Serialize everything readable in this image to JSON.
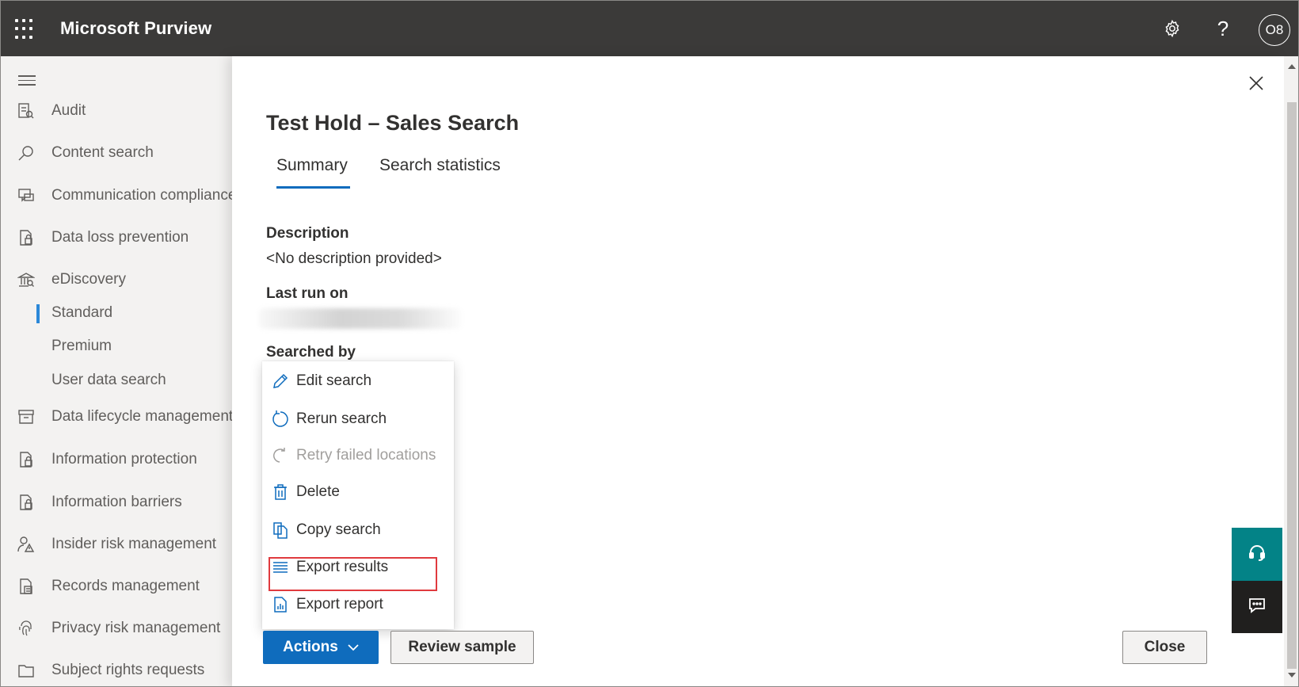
{
  "app": {
    "title": "Microsoft Purview",
    "user_initials": "O8"
  },
  "header": {
    "icons": [
      "waffle-icon",
      "settings-icon",
      "help-icon"
    ],
    "help_glyph": "?"
  },
  "sidebar": {
    "items": [
      {
        "label": "Audit",
        "icon": "audit-icon"
      },
      {
        "label": "Content search",
        "icon": "search-icon"
      },
      {
        "label": "Communication compliance",
        "icon": "chat-icon"
      },
      {
        "label": "Data loss prevention",
        "icon": "lock-document-icon"
      },
      {
        "label": "eDiscovery",
        "icon": "building-icon"
      },
      {
        "label": "Data lifecycle management",
        "icon": "archive-icon"
      },
      {
        "label": "Information protection",
        "icon": "lock-document-icon"
      },
      {
        "label": "Information barriers",
        "icon": "lock-document-icon"
      },
      {
        "label": "Insider risk management",
        "icon": "person-warning-icon"
      },
      {
        "label": "Records management",
        "icon": "records-icon"
      },
      {
        "label": "Privacy risk management",
        "icon": "fingerprint-icon"
      },
      {
        "label": "Subject rights requests",
        "icon": "folder-icon"
      }
    ],
    "ediscovery_sub": [
      "Standard",
      "Premium",
      "User data search"
    ],
    "selected_sub": "Standard"
  },
  "panel": {
    "title": "Test Hold – Sales Search",
    "tabs": [
      {
        "label": "Summary",
        "active": true
      },
      {
        "label": "Search statistics",
        "active": false
      }
    ],
    "fields": {
      "description_label": "Description",
      "description_value": "<No description provided>",
      "last_run_label": "Last run on",
      "searched_by_label": "Searched by"
    }
  },
  "menu": {
    "items": [
      {
        "label": "Edit search",
        "icon": "pencil-icon",
        "disabled": false
      },
      {
        "label": "Rerun search",
        "icon": "refresh-icon",
        "disabled": false
      },
      {
        "label": "Retry failed locations",
        "icon": "retry-icon",
        "disabled": true
      },
      {
        "label": "Delete",
        "icon": "trash-icon",
        "disabled": false
      },
      {
        "label": "Copy search",
        "icon": "copy-icon",
        "disabled": false
      },
      {
        "label": "Export results",
        "icon": "list-icon",
        "disabled": false,
        "highlighted": true
      },
      {
        "label": "Export report",
        "icon": "report-icon",
        "disabled": false
      }
    ]
  },
  "footer": {
    "actions_label": "Actions",
    "review_label": "Review sample",
    "close_label": "Close"
  },
  "colors": {
    "accent": "#0f6cbd",
    "topbar": "#3b3a39",
    "highlight": "#e03a3e",
    "support": "#038387"
  }
}
